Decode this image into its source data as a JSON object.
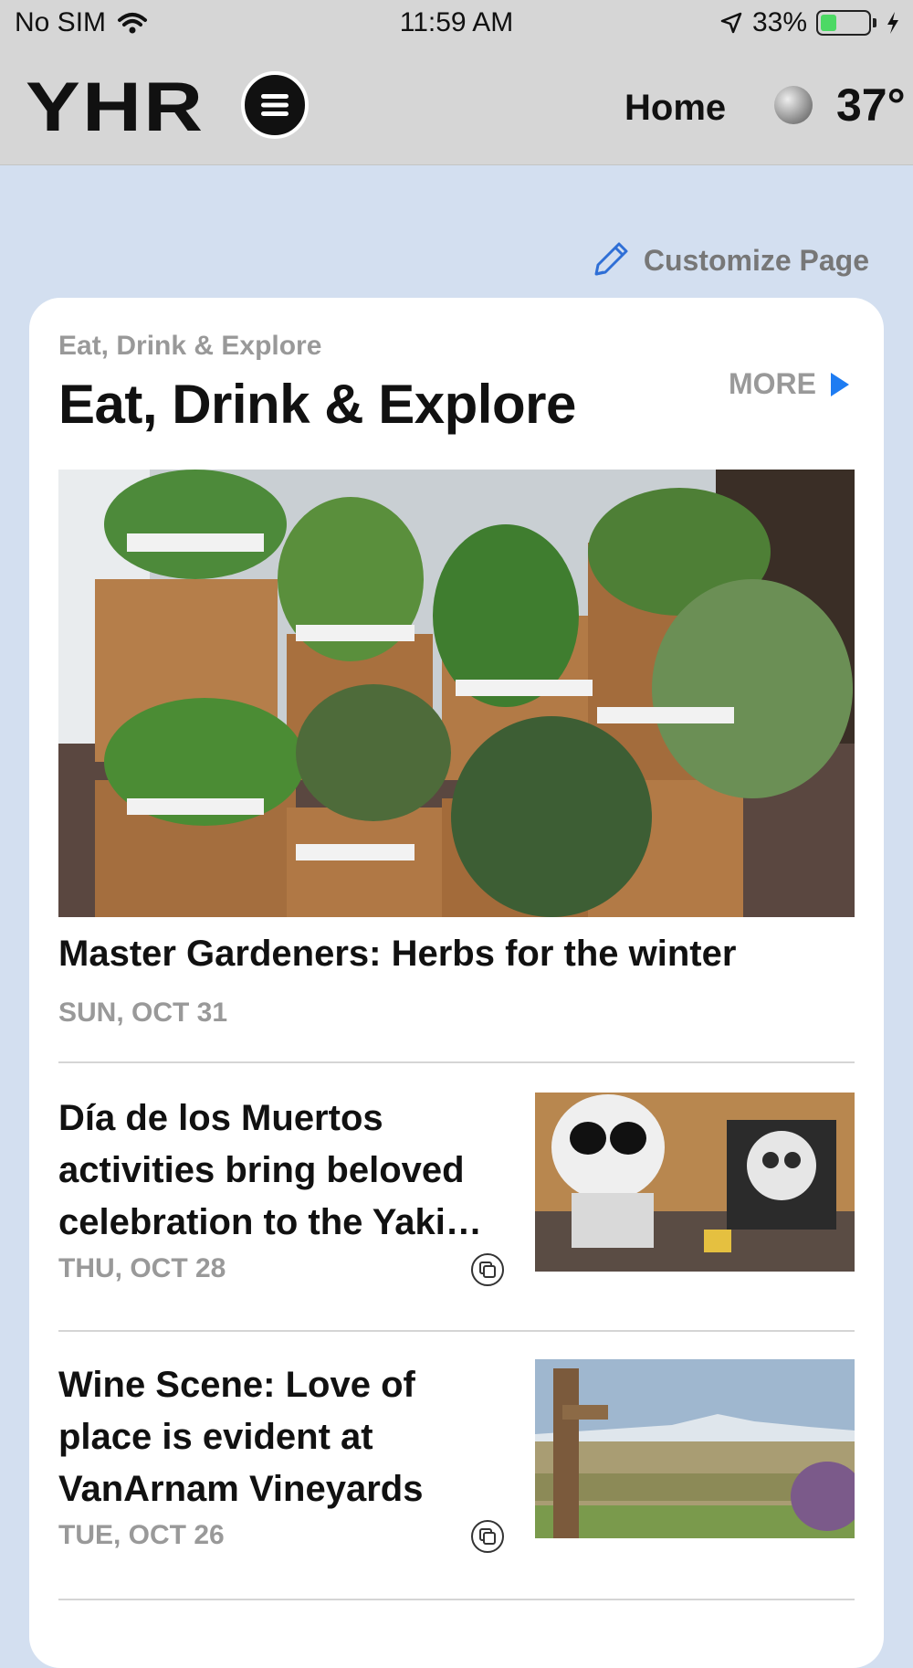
{
  "status_bar": {
    "carrier": "No SIM",
    "time": "11:59 AM",
    "battery_percent": "33%",
    "battery_level": 0.33,
    "wifi_icon": "wifi-icon",
    "location_icon": "location-arrow-icon",
    "charging_icon": "bolt-icon"
  },
  "header": {
    "logo": "YHR",
    "menu_icon": "hamburger-icon",
    "home_label": "Home",
    "weather_icon": "moon-icon",
    "temperature": "37°"
  },
  "customize": {
    "label": "Customize Page",
    "icon": "pencil-icon",
    "accent": "#2f6fd6"
  },
  "section": {
    "eyebrow": "Eat, Drink & Explore",
    "title": "Eat, Drink & Explore",
    "more_label": "MORE",
    "more_icon": "triangle-right-icon",
    "more_color": "#1e7cf2",
    "hero": {
      "headline": "Master Gardeners: Herbs for the winter",
      "date": "SUN, OCT 31",
      "image": "herb planters photo"
    },
    "stories": [
      {
        "headline": "Día de los Muertos activities bring beloved celebration to the Yaki…",
        "date": "THU, OCT 28",
        "icon": "gallery-icon",
        "image": "sugar skull display photo"
      },
      {
        "headline": "Wine Scene: Love of place is evident at VanArnam Vineyards",
        "date": "TUE, OCT 26",
        "icon": "gallery-icon",
        "image": "vineyard and mountain photo"
      }
    ]
  }
}
